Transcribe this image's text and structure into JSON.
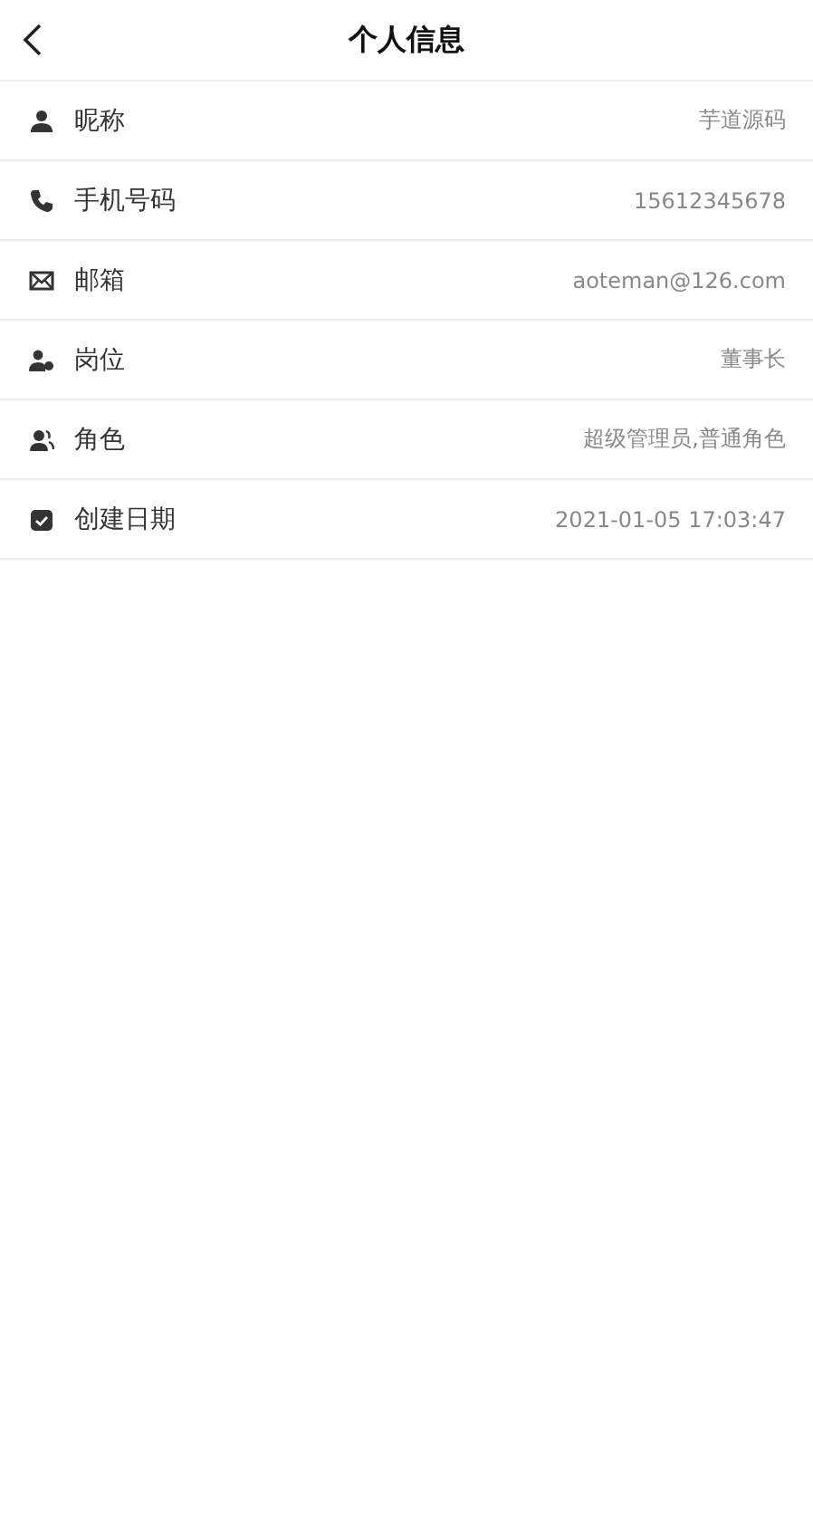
{
  "header": {
    "title": "个人信息"
  },
  "rows": [
    {
      "kind": "user",
      "label": "昵称",
      "value": "芋道源码"
    },
    {
      "kind": "phone",
      "label": "手机号码",
      "value": "15612345678"
    },
    {
      "kind": "mail",
      "label": "邮箱",
      "value": "aoteman@126.com"
    },
    {
      "kind": "post",
      "label": "岗位",
      "value": "董事长"
    },
    {
      "kind": "role",
      "label": "角色",
      "value": "超级管理员,普通角色"
    },
    {
      "kind": "date",
      "label": "创建日期",
      "value": "2021-01-05 17:03:47"
    }
  ]
}
